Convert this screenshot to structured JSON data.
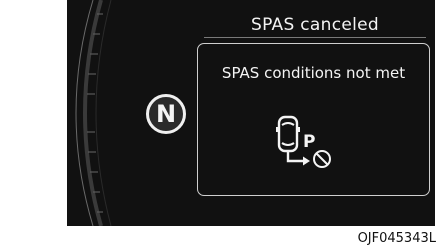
{
  "header": {
    "title": "SPAS canceled"
  },
  "gear_indicator": {
    "value": "N"
  },
  "message": {
    "text": "SPAS conditions not met",
    "icons": [
      "car-top-view-icon",
      "parking-p-icon",
      "prohibited-icon",
      "exit-arrow-icon"
    ],
    "parking_label": "P"
  },
  "figure_code": "OJF045343L",
  "colors": {
    "cluster_background": "#111111",
    "text": "#f4f4f4",
    "border": "#cfcfcf"
  }
}
